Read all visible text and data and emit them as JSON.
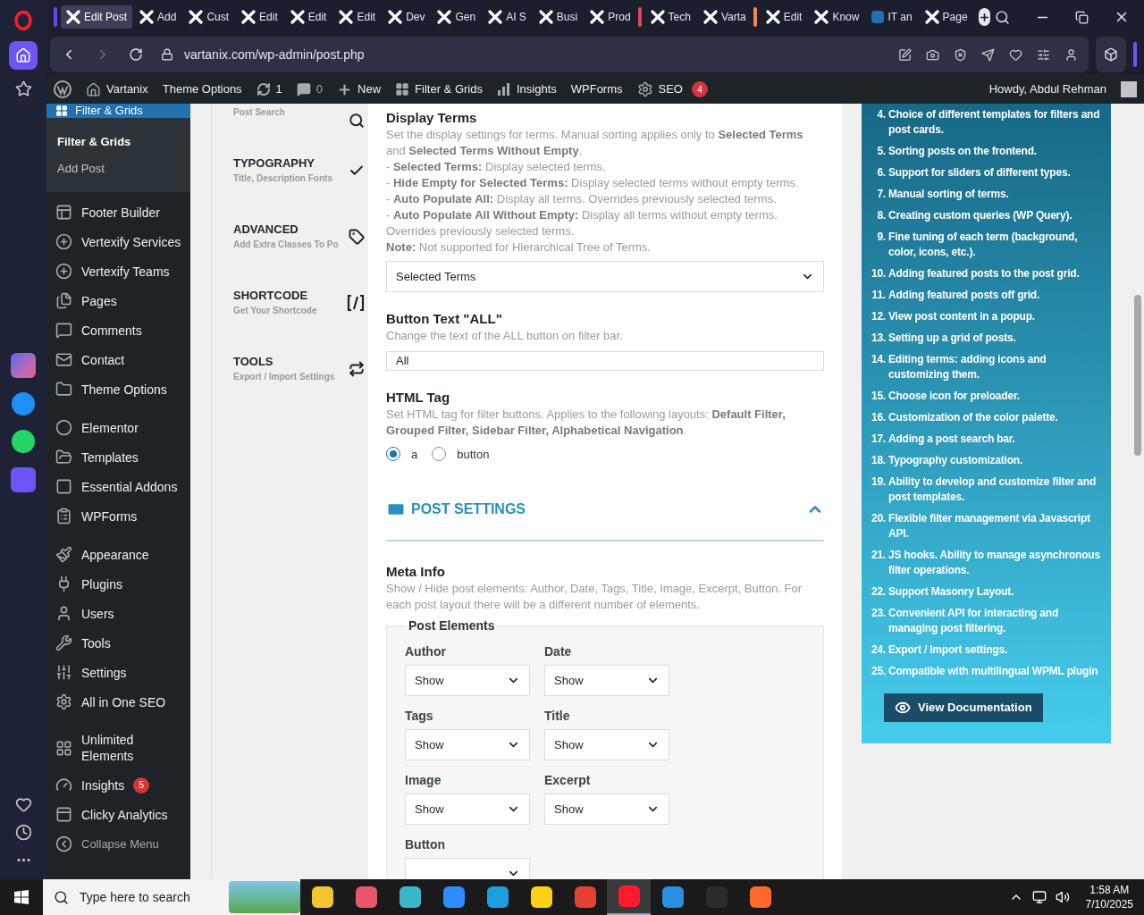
{
  "browser": {
    "tabs": [
      {
        "label": "Edit Post",
        "selected": true,
        "color": "#5b4cf0"
      },
      {
        "label": "Add",
        "selected": false
      },
      {
        "label": "Cust",
        "selected": false
      },
      {
        "label": "Edit",
        "selected": false
      },
      {
        "label": "Edit",
        "selected": false
      },
      {
        "label": "Edit",
        "selected": false
      },
      {
        "label": "Dev",
        "selected": false
      },
      {
        "label": "Gen",
        "selected": false
      },
      {
        "label": "AI S",
        "selected": false
      },
      {
        "label": "Busi",
        "selected": false
      },
      {
        "label": "Prod",
        "selected": false
      },
      {
        "label": "Tech",
        "selected": false,
        "color": "#e0475a"
      },
      {
        "label": "Varta",
        "selected": false
      },
      {
        "label": "Edit",
        "selected": false,
        "color": "#f08a4b"
      },
      {
        "label": "Know",
        "selected": false
      },
      {
        "label": "IT an",
        "selected": false
      },
      {
        "label": "Page",
        "selected": false
      }
    ],
    "url": "vartanix.com/wp-admin/post.php"
  },
  "admin_bar": {
    "site": "Vartanix",
    "theme_options": "Theme Options",
    "updates": "1",
    "comments": "0",
    "new": "New",
    "filter_grids": "Filter & Grids",
    "insights": "Insights",
    "wpforms": "WPForms",
    "seo": "SEO",
    "seo_badge": "4",
    "howdy": "Howdy, Abdul Rehman"
  },
  "sidebar": {
    "current": "Filter & Grids",
    "submenu": [
      {
        "label": "Filter & Grids",
        "selected": true
      },
      {
        "label": "Add Post",
        "selected": false
      }
    ],
    "groups": [
      [
        {
          "label": "Footer Builder",
          "kind": "link"
        },
        {
          "label": "Vertexify Services",
          "kind": "link"
        },
        {
          "label": "Vertexify Teams",
          "kind": "link"
        },
        {
          "label": "Pages",
          "kind": "link"
        },
        {
          "label": "Comments",
          "kind": "link"
        },
        {
          "label": "Contact",
          "kind": "link"
        },
        {
          "label": "Theme Options",
          "kind": "link"
        }
      ],
      [
        {
          "label": "Elementor",
          "kind": "link"
        },
        {
          "label": "Templates",
          "kind": "link"
        },
        {
          "label": "Essential Addons",
          "kind": "link"
        },
        {
          "label": "WPForms",
          "kind": "link"
        }
      ],
      [
        {
          "label": "Appearance",
          "kind": "link"
        },
        {
          "label": "Plugins",
          "kind": "link"
        },
        {
          "label": "Users",
          "kind": "link"
        },
        {
          "label": "Tools",
          "kind": "link"
        },
        {
          "label": "Settings",
          "kind": "link"
        },
        {
          "label": "All in One SEO",
          "kind": "link"
        }
      ],
      [
        {
          "label": "Unlimited Elements",
          "kind": "link"
        },
        {
          "label": "Insights",
          "kind": "link",
          "badge": "5"
        },
        {
          "label": "Clicky Analytics",
          "kind": "link"
        },
        {
          "label": "Collapse Menu",
          "kind": "collapse"
        }
      ]
    ]
  },
  "settings_nav": [
    {
      "subtitle": "Post Search"
    },
    {
      "title": "TYPOGRAPHY",
      "subtitle": "Title, Description Fonts"
    },
    {
      "title": "ADVANCED",
      "subtitle": "Add Extra Classes To Po"
    },
    {
      "title": "SHORTCODE",
      "subtitle": "Get Your Shortcode"
    },
    {
      "title": "TOOLS",
      "subtitle": "Export / Import Settings"
    }
  ],
  "display_terms": {
    "title": "Display Terms",
    "description": [
      "Set the display settings for terms. Manual sorting applies only to **Selected Terms** and **Selected Terms Without Empty**.",
      "- **Selected Terms:** Display selected terms.",
      "- **Hide Empty for Selected Terms:** Display selected terms without empty terms.",
      "- **Auto Populate All:** Display all terms. Overrides previously selected terms.",
      "- **Auto Populate All Without Empty:** Display all terms without empty terms. Overrides previously selected terms.",
      "**Note:** Not supported for Hierarchical Tree of Terms."
    ],
    "value": "Selected Terms"
  },
  "button_text": {
    "title": "Button Text \"ALL\"",
    "description": "Change the text of the ALL button on filter bar.",
    "value": "All"
  },
  "html_tag": {
    "title": "HTML Tag",
    "description": "Set HTML tag for filter buttons. Applies to the following layouts: **Default Filter, Grouped Filter, Sidebar Filter, Alphabetical Navigation**.",
    "options": [
      {
        "label": "a",
        "selected": true
      },
      {
        "label": "button",
        "selected": false
      }
    ]
  },
  "post_settings": {
    "title": "POST SETTINGS",
    "expanded": true
  },
  "meta_info": {
    "title": "Meta Info",
    "description": "Show / Hide post elements: Author, Date, Tags, Title, Image, Excerpt, Button. For each post layout there will be a different number of elements.",
    "legend": "Post Elements",
    "fields": [
      {
        "label": "Author",
        "value": "Show"
      },
      {
        "label": "Date",
        "value": "Show"
      },
      {
        "label": "Tags",
        "value": "Show"
      },
      {
        "label": "Title",
        "value": "Show"
      },
      {
        "label": "Image",
        "value": "Show"
      },
      {
        "label": "Excerpt",
        "value": "Show"
      },
      {
        "label": "Button"
      }
    ]
  },
  "features": {
    "items": [
      {
        "number": "4.",
        "text": "Choice of different templates for filters and post cards."
      },
      {
        "number": "5.",
        "text": "Sorting posts on the frontend."
      },
      {
        "number": "6.",
        "text": "Support for sliders of different types."
      },
      {
        "number": "7.",
        "text": "Manual sorting of terms."
      },
      {
        "number": "8.",
        "text": "Creating custom queries (WP Query)."
      },
      {
        "number": "9.",
        "text": "Fine tuning of each term (background, color, icons, etc.)."
      },
      {
        "number": "10.",
        "text": "Adding featured posts to the post grid."
      },
      {
        "number": "11.",
        "text": "Adding featured posts off grid."
      },
      {
        "number": "12.",
        "text": "View post content in a popup."
      },
      {
        "number": "13.",
        "text": "Setting up a grid of posts."
      },
      {
        "number": "14.",
        "text": "Editing terms: adding icons and customizing them."
      },
      {
        "number": "15.",
        "text": "Choose icon for preloader."
      },
      {
        "number": "16.",
        "text": "Customization of the color palette."
      },
      {
        "number": "17.",
        "text": "Adding a post search bar."
      },
      {
        "number": "18.",
        "text": "Typography customization."
      },
      {
        "number": "19.",
        "text": "Ability to develop and customize filter and post templates."
      },
      {
        "number": "20.",
        "text": "Flexible filter management via Javascript API."
      },
      {
        "number": "21.",
        "text": "JS hooks. Ability to manage asynchronous filter operations."
      },
      {
        "number": "22.",
        "text": "Support Masonry Layout."
      },
      {
        "number": "23.",
        "text": "Convenient API for interacting and managing post filtering."
      },
      {
        "number": "24.",
        "text": "Export / Import settings."
      },
      {
        "number": "25.",
        "text": "Compatible with multilingual WPML plugin"
      }
    ],
    "button": "View Documentation"
  },
  "taskbar": {
    "search_placeholder": "Type here to search",
    "time": "1:58 AM",
    "date": "7/10/2025"
  }
}
